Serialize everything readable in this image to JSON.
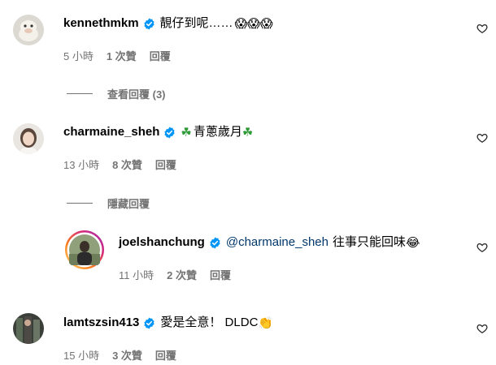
{
  "comments": [
    {
      "username": "kennethmkm",
      "text": "靚仔到呢……",
      "emoji": "😱😱😱",
      "time": "5 小時",
      "likes": "1 次贊",
      "reply": "回覆"
    },
    {
      "username": "charmaine_sheh",
      "emoji_before": "☘",
      "text": "青蔥歲月",
      "emoji": "☘",
      "time": "13 小時",
      "likes": "8 次贊",
      "reply": "回覆"
    },
    {
      "username": "joelshanchung",
      "mention": "@charmaine_sheh",
      "text": "往事只能回味",
      "emoji": "😂",
      "time": "11 小時",
      "likes": "2 次贊",
      "reply": "回覆"
    },
    {
      "username": "lamtszsin413",
      "text": "愛是全意！ DLDC",
      "emoji": "👏",
      "time": "15 小時",
      "likes": "3 次贊",
      "reply": "回覆"
    }
  ],
  "toggles": {
    "view_replies": "查看回覆 (3)",
    "hide_replies": "隱藏回覆"
  },
  "colors": {
    "verified": "#0095f6",
    "meta": "#737373",
    "mention": "#00376b",
    "story_ring": [
      "#feda75",
      "#fa7e1e",
      "#d62976",
      "#962fbf"
    ]
  }
}
